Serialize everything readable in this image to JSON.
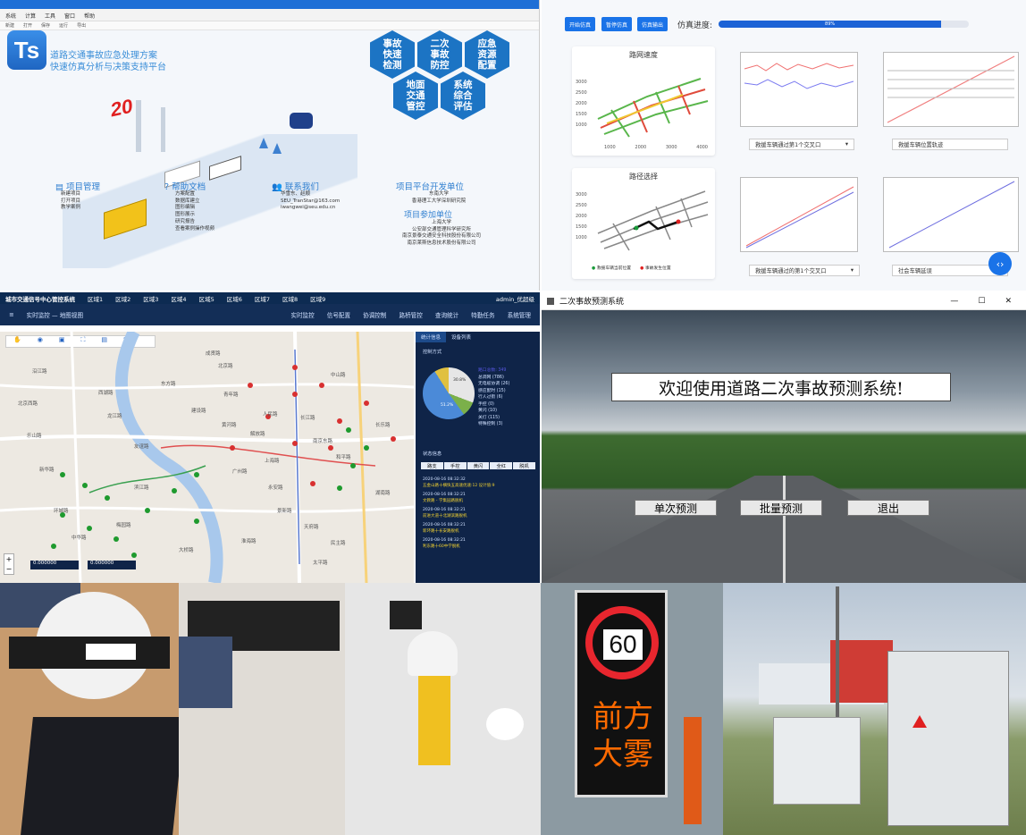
{
  "p1": {
    "menu": [
      "系统",
      "计算",
      "工具",
      "窗口",
      "帮助"
    ],
    "tools": [
      "新建",
      "打开",
      "保存",
      "运行",
      "导出"
    ],
    "logo": "Ts",
    "title1": "道路交通事故应急处理方案",
    "title2": "快速仿真分析与决策支持平台",
    "sign": "20",
    "hexes": [
      "事故快速检测",
      "二次事故防控",
      "应急资源配置",
      "地面交通管控",
      "系统综合评估"
    ],
    "proj": {
      "title": "项目管理",
      "items": [
        "新建项目",
        "打开项目",
        "教学案例"
      ]
    },
    "help": {
      "title": "帮助文档",
      "items": [
        "方案配置",
        "数据库建立",
        "图形编辑",
        "图形展示",
        "研究报告",
        "查看案例操作视频"
      ]
    },
    "contact": {
      "title": "联系我们",
      "items": [
        "华雪东、赵顺",
        "SEU_TranStar@163.com",
        "iwangwei@seu.edu.cn"
      ]
    },
    "dev": {
      "title": "项目平台开发单位",
      "lines": [
        "东南大学",
        "香港理工大学深圳研究院"
      ]
    },
    "part": {
      "title": "项目参加单位",
      "lines": [
        "上海大学",
        "公安部交通管理科学研究所",
        "南京景泰交通安全科技股份有限公司",
        "南京莱斯信息技术股份有限公司"
      ]
    }
  },
  "p2": {
    "buttons": [
      "开始仿真",
      "暂停仿真",
      "仿真输出"
    ],
    "progress_label": "仿真进度:",
    "progress_text": "89%",
    "progress_value": 0.89,
    "card1_title": "路网速度",
    "card1_yticks": [
      "3000",
      "2500",
      "2000",
      "1500",
      "1000"
    ],
    "card1_xticks": [
      "1000",
      "2000",
      "3000",
      "4000"
    ],
    "card2_title": "路径选择",
    "card2_yticks": [
      "3000",
      "2500",
      "2000",
      "1500",
      "1000"
    ],
    "card2_legend": [
      "救援车辆当前位置",
      "事故发生位置"
    ],
    "selects": [
      "救援车辆通过第1个交叉口",
      "救援车辆位置轨迹",
      "救援车辆通过的第1个交叉口",
      "社会车辆延误"
    ],
    "nav_icon": "code-brackets-icon"
  },
  "p3": {
    "title": "城市交通信号中心管控系统",
    "tabs": [
      "区域1",
      "区域2",
      "区域3",
      "区域4",
      "区域5",
      "区域6",
      "区域7",
      "区域8",
      "区域9"
    ],
    "user": "admin_优超级",
    "crumb": "实时监控 — 地图视图",
    "nav": [
      "实时监控",
      "信号配置",
      "协调控制",
      "路桥管控",
      "查询统计",
      "特勤任务",
      "系统管理"
    ],
    "side_tabs": [
      "统计信息",
      "设备列表"
    ],
    "control_mode": "控制方式",
    "total": "路口总数: 349",
    "legend": [
      "总调网 (786)",
      "无电缆协调 (26)",
      "感应配时 (15)",
      "行人过街 (6)",
      "手控 (0)",
      "黄闪 (10)",
      "关灯 (115)",
      "特殊控制 (3)"
    ],
    "pie_labels": [
      "30.8%",
      "51.2%"
    ],
    "status_title": "状态信息",
    "status_cols": [
      "路支",
      "手控",
      "黄闪",
      "全红",
      "脱机"
    ],
    "events": [
      {
        "t": "2020-08-16  08:32:32",
        "m": "五金山路十横快五高速优速:12 设计值:9"
      },
      {
        "t": "2020-08-16  08:32:21",
        "m": "文教路 - 学集园路脱机"
      },
      {
        "t": "2020-08-16  08:32:21",
        "m": "前进大道十北湖滨路脱机"
      },
      {
        "t": "2020-08-16  08:32:21",
        "m": "新环路十长安路脱机"
      },
      {
        "t": "2020-08-16  08:32:21",
        "m": "利东路十60中学脱机"
      }
    ],
    "coord1": "0.000000",
    "coord2": "0.000000",
    "map_labels": [
      "乐山路",
      "北京路",
      "东方路",
      "西湖路",
      "中山路",
      "人民路",
      "长江路",
      "解放路",
      "建设路",
      "黄河路",
      "新华路",
      "南京东路",
      "和平路",
      "上海路",
      "友谊路",
      "北京西路",
      "环城路",
      "滨江路",
      "永安路",
      "景新路",
      "天府路",
      "中华路",
      "民主路",
      "太平路",
      "广州路",
      "成贤路",
      "沿江路",
      "龙江路",
      "大桥路",
      "淮海路",
      "梅园路",
      "长乐路",
      "湖南路",
      "青年路"
    ]
  },
  "p4": {
    "title": "二次事故预测系统",
    "welcome": "欢迎使用道路二次事故预测系统!",
    "b1": "单次预测",
    "b2": "批量预测",
    "b3": "退出"
  },
  "photos": {
    "sign_speed": "60",
    "sign_text1": "前方",
    "sign_text2": "大雾"
  }
}
